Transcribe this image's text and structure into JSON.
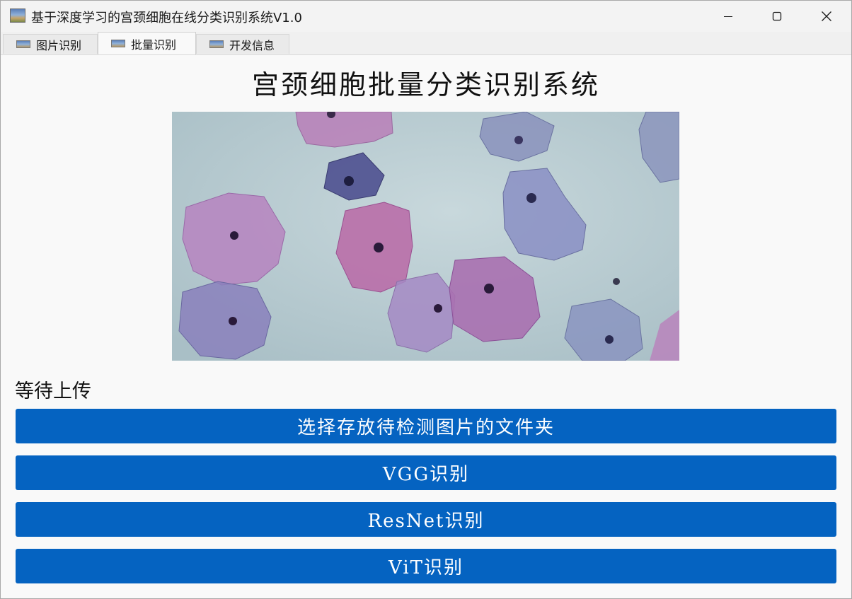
{
  "window": {
    "title": "基于深度学习的宫颈细胞在线分类识别系统V1.0"
  },
  "tabs": [
    {
      "label": "图片识别",
      "active": false
    },
    {
      "label": "批量识别",
      "active": true
    },
    {
      "label": "开发信息",
      "active": false
    }
  ],
  "main": {
    "heading": "宫颈细胞批量分类识别系统",
    "image_icon": "cervical-cell-microscopy-image",
    "status": "等待上传",
    "buttons": {
      "select_folder": "选择存放待检测图片的文件夹",
      "vgg": "VGG识别",
      "resnet": "ResNet识别",
      "vit": "ViT识别"
    }
  },
  "colors": {
    "button_bg": "#0563c1",
    "button_text": "#ffffff",
    "window_bg": "#f9f9f9"
  }
}
